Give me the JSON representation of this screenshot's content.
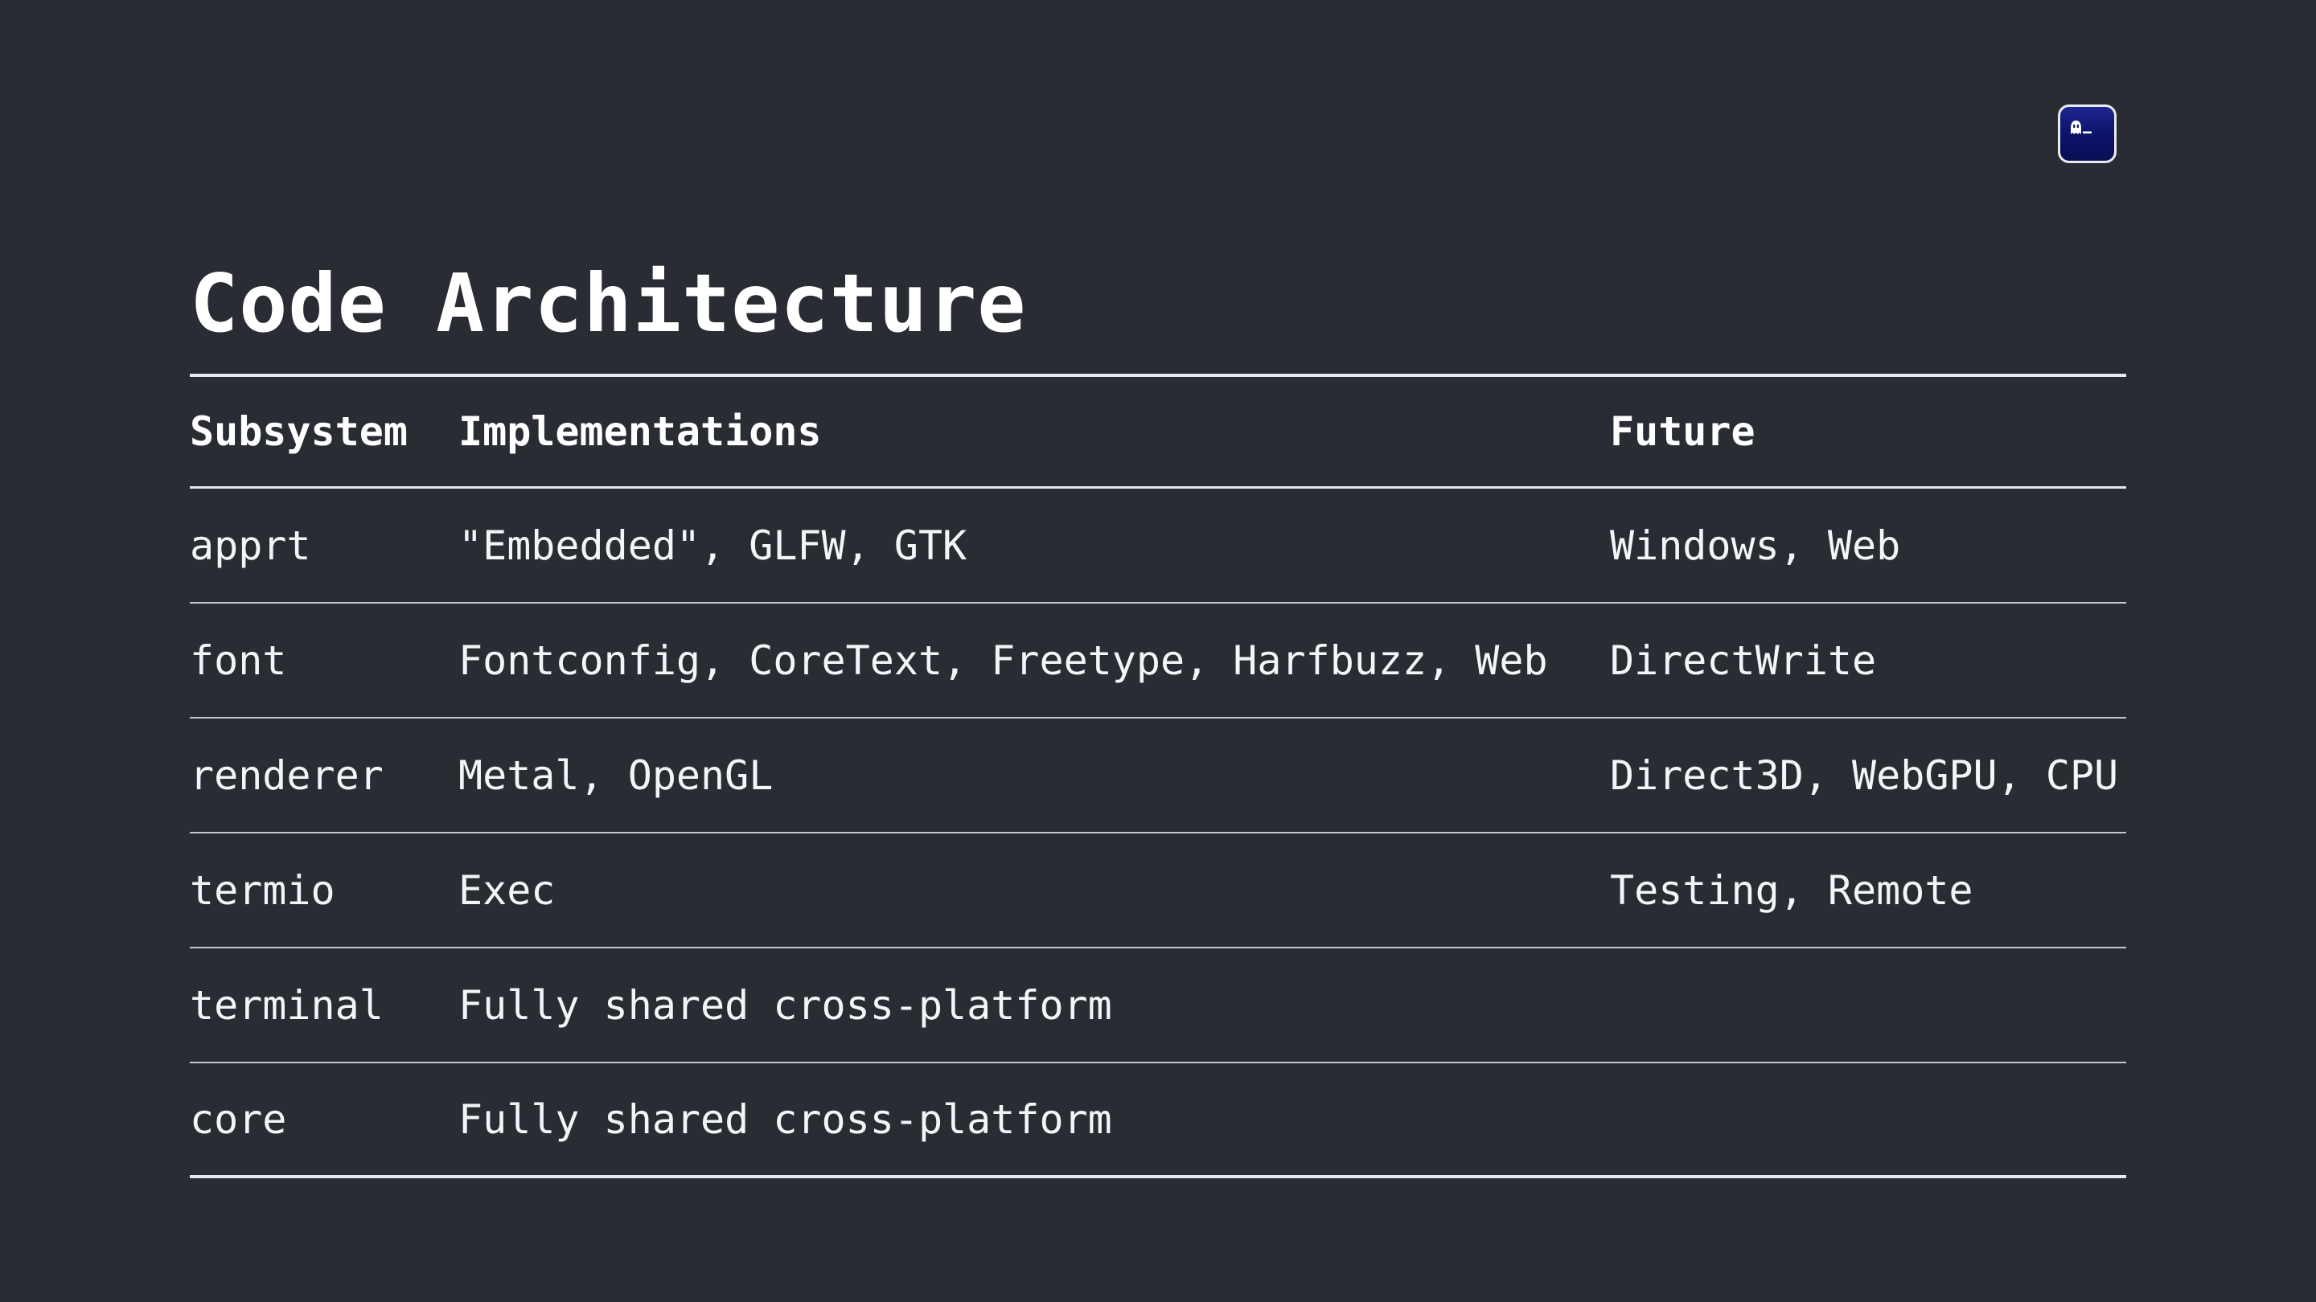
{
  "slide": {
    "title": "Code Architecture",
    "logo_icon": "ghostty-terminal-icon"
  },
  "table": {
    "headers": [
      "Subsystem",
      "Implementations",
      "Future"
    ],
    "rows": [
      [
        "apprt",
        "\"Embedded\", GLFW, GTK",
        "Windows, Web"
      ],
      [
        "font",
        "Fontconfig, CoreText, Freetype, Harfbuzz, Web",
        "DirectWrite"
      ],
      [
        "renderer",
        "Metal, OpenGL",
        "Direct3D, WebGPU, CPU"
      ],
      [
        "termio",
        "Exec",
        "Testing, Remote"
      ],
      [
        "terminal",
        "Fully shared cross-platform",
        ""
      ],
      [
        "core",
        "Fully shared cross-platform",
        ""
      ]
    ]
  },
  "colors": {
    "background": "#292c33",
    "text": "#ffffff",
    "rule": "#e8e9ec",
    "logo_fill": "#0c1266"
  }
}
